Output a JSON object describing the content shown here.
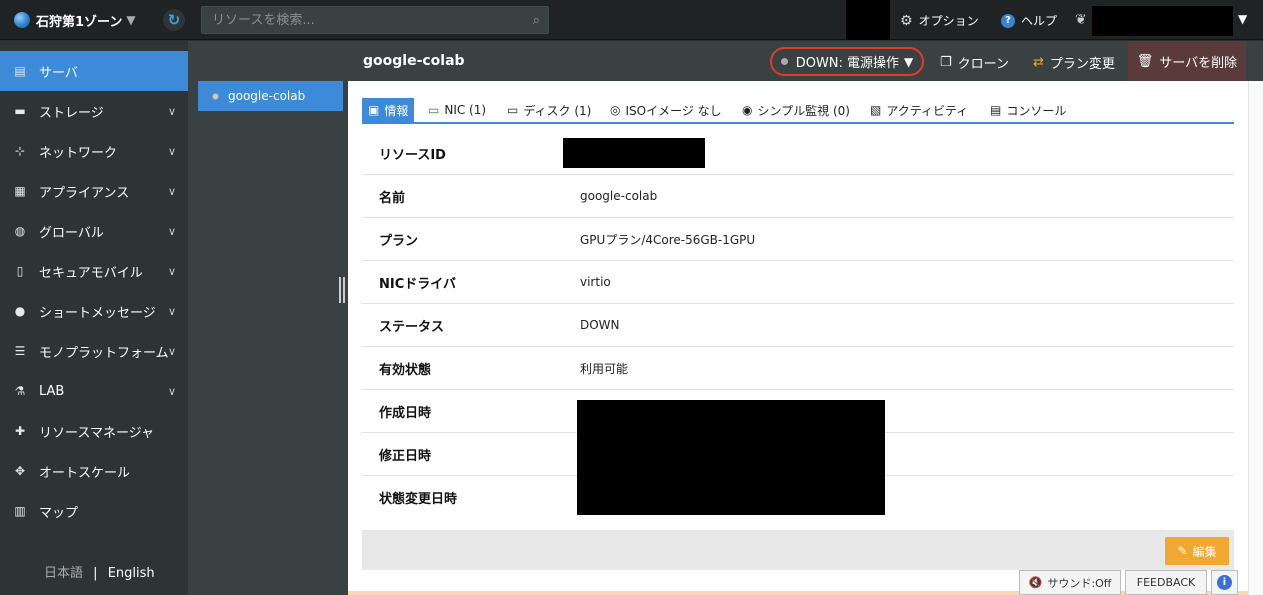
{
  "topbar": {
    "zone": "石狩第1ゾーン",
    "search_placeholder": "リソースを検索...",
    "options": "オプション",
    "help": "ヘルプ"
  },
  "sidebar": {
    "items": [
      {
        "label": "サーバ",
        "icon": "server-icon",
        "active": true
      },
      {
        "label": "ストレージ",
        "icon": "storage-icon"
      },
      {
        "label": "ネットワーク",
        "icon": "network-icon"
      },
      {
        "label": "アプライアンス",
        "icon": "grid-icon"
      },
      {
        "label": "グローバル",
        "icon": "globe-icon"
      },
      {
        "label": "セキュアモバイル",
        "icon": "mobile-icon"
      },
      {
        "label": "ショートメッセージ",
        "icon": "chat-icon"
      },
      {
        "label": "モノプラットフォーム",
        "icon": "list-icon"
      },
      {
        "label": "LAB",
        "icon": "flask-icon"
      },
      {
        "label": "リソースマネージャ",
        "icon": "puzzle-icon"
      },
      {
        "label": "オートスケール",
        "icon": "move-icon"
      },
      {
        "label": "マップ",
        "icon": "map-icon"
      }
    ],
    "lang_ja": "日本語",
    "lang_sep": "|",
    "lang_en": "English"
  },
  "server_list": {
    "selected": "google-colab"
  },
  "header": {
    "title": "google-colab",
    "power": "DOWN: 電源操作",
    "clone": "クローン",
    "plan_change": "プラン変更",
    "delete": "サーバを削除"
  },
  "tabs": [
    {
      "label": "情報",
      "active": true
    },
    {
      "label": "NIC (1)"
    },
    {
      "label": "ディスク (1)"
    },
    {
      "label": "ISOイメージ なし"
    },
    {
      "label": "シンプル監視 (0)"
    },
    {
      "label": "アクティビティ"
    },
    {
      "label": "コンソール"
    }
  ],
  "info": {
    "rows": [
      {
        "label": "リソースID",
        "value": ""
      },
      {
        "label": "名前",
        "value": "google-colab"
      },
      {
        "label": "プラン",
        "value": "GPUプラン/4Core-56GB-1GPU"
      },
      {
        "label": "NICドライバ",
        "value": "virtio"
      },
      {
        "label": "ステータス",
        "value": "DOWN"
      },
      {
        "label": "有効状態",
        "value": "利用可能"
      },
      {
        "label": "作成日時",
        "value": ""
      },
      {
        "label": "修正日時",
        "value": ""
      },
      {
        "label": "状態変更日時",
        "value": ""
      }
    ]
  },
  "footer": {
    "edit": "編集",
    "sound": "サウンド:Off",
    "feedback": "FEEDBACK",
    "info_icon": "i"
  },
  "colors": {
    "accent": "#3d8ad8",
    "power_outline": "#e03a2a",
    "edit": "#f0a830",
    "delete_bg": "#5a3a3a"
  }
}
